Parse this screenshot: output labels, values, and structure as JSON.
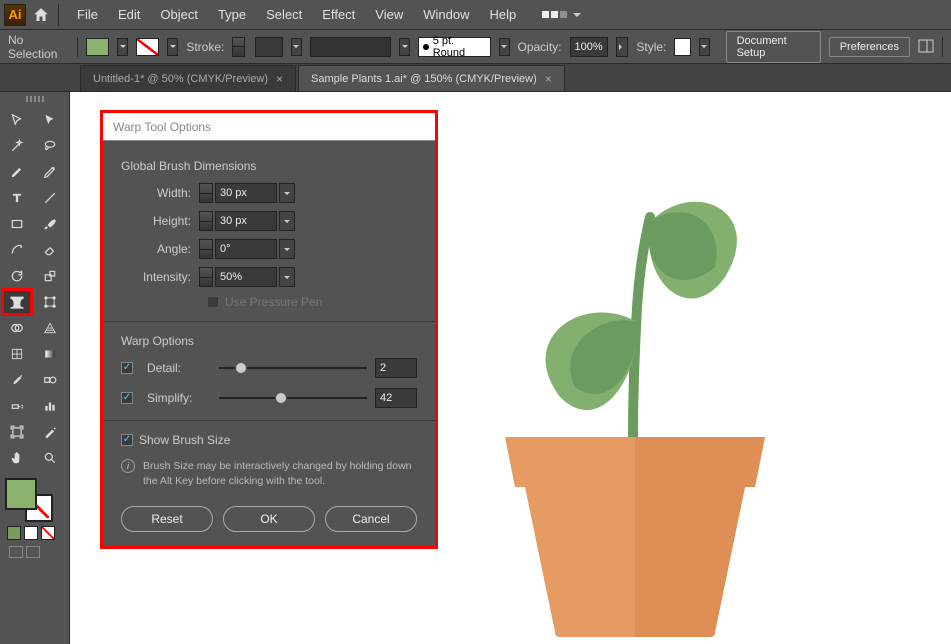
{
  "menu": {
    "items": [
      "File",
      "Edit",
      "Object",
      "Type",
      "Select",
      "Effect",
      "View",
      "Window",
      "Help"
    ]
  },
  "optionsBar": {
    "selectionLabel": "No Selection",
    "strokeLabel": "Stroke:",
    "brushLabel": "5 pt. Round",
    "opacityLabel": "Opacity:",
    "opacityValue": "100%",
    "styleLabel": "Style:",
    "documentSetup": "Document Setup",
    "preferences": "Preferences"
  },
  "tabs": [
    {
      "label": "Untitled-1* @ 50% (CMYK/Preview)",
      "active": false
    },
    {
      "label": "Sample Plants 1.ai* @ 150% (CMYK/Preview)",
      "active": true
    }
  ],
  "dialog": {
    "title": "Warp Tool Options",
    "globalTitle": "Global Brush Dimensions",
    "widthLabel": "Width:",
    "widthValue": "30 px",
    "heightLabel": "Height:",
    "heightValue": "30 px",
    "angleLabel": "Angle:",
    "angleValue": "0°",
    "intensityLabel": "Intensity:",
    "intensityValue": "50%",
    "pressurePen": "Use Pressure Pen",
    "warpTitle": "Warp Options",
    "detailLabel": "Detail:",
    "detailValue": "2",
    "simplifyLabel": "Simplify:",
    "simplifyValue": "42",
    "showBrush": "Show Brush Size",
    "infoText": "Brush Size may be interactively changed by holding down the Alt Key before clicking with the tool.",
    "reset": "Reset",
    "ok": "OK",
    "cancel": "Cancel"
  }
}
